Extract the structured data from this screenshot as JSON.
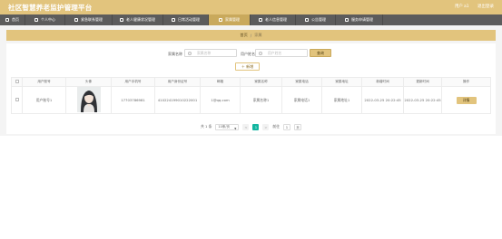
{
  "header": {
    "app_title": "社区智慧养老监护管理平台",
    "user_label": "用户",
    "username": "a1",
    "logout_label": "退出登录"
  },
  "nav": {
    "items": [
      {
        "label": "首页",
        "icon": "home-icon"
      },
      {
        "label": "个人中心",
        "icon": "user-icon"
      },
      {
        "label": "紧急联系管理",
        "icon": "contact-icon"
      },
      {
        "label": "老人健康状况管理",
        "icon": "health-icon"
      },
      {
        "label": "日常活动管理",
        "icon": "activity-icon"
      },
      {
        "label": "家属管理",
        "icon": "family-icon",
        "active": true
      },
      {
        "label": "老人信息管理",
        "icon": "elder-icon"
      },
      {
        "label": "公告管理",
        "icon": "notice-icon"
      },
      {
        "label": "服务申请管理",
        "icon": "service-icon"
      }
    ]
  },
  "breadcrumb": {
    "home": "首页",
    "separator": "/",
    "current": "家属"
  },
  "search": {
    "field1_label": "家属名称",
    "field1_placeholder": "家属名称",
    "field2_label": "用户姓名",
    "field2_placeholder": "用户姓名",
    "button_label": "查询"
  },
  "toolbar": {
    "add_label": "＋ 新增"
  },
  "table": {
    "headers": [
      "",
      "用户账号",
      "头像",
      "用户手机号",
      "用户身份证号",
      "邮箱",
      "家属名称",
      "家属电话",
      "家属地址",
      "新增时间",
      "更新时间",
      "操作"
    ],
    "rows": [
      {
        "account": "用户账号1",
        "phone": "17703786981",
        "id_number": "410224199010222001",
        "email": "1@qq.com",
        "family_name": "家属名称1",
        "family_phone": "家属电话1",
        "family_address": "家属地址1",
        "created": "2022-03-25 20:22:45",
        "updated": "2022-03-25 20:22:45",
        "action_label": "详情"
      }
    ]
  },
  "pagination": {
    "total_label": "共 1 条",
    "page_size_label": "10条/页",
    "prev": "<",
    "current_page": "1",
    "next": ">",
    "goto_label": "前往",
    "goto_value": "1",
    "page_suffix": "页"
  },
  "colors": {
    "accent": "#e2c47d",
    "nav_bg": "#5c5c5c",
    "pager_active": "#13b5a0"
  }
}
